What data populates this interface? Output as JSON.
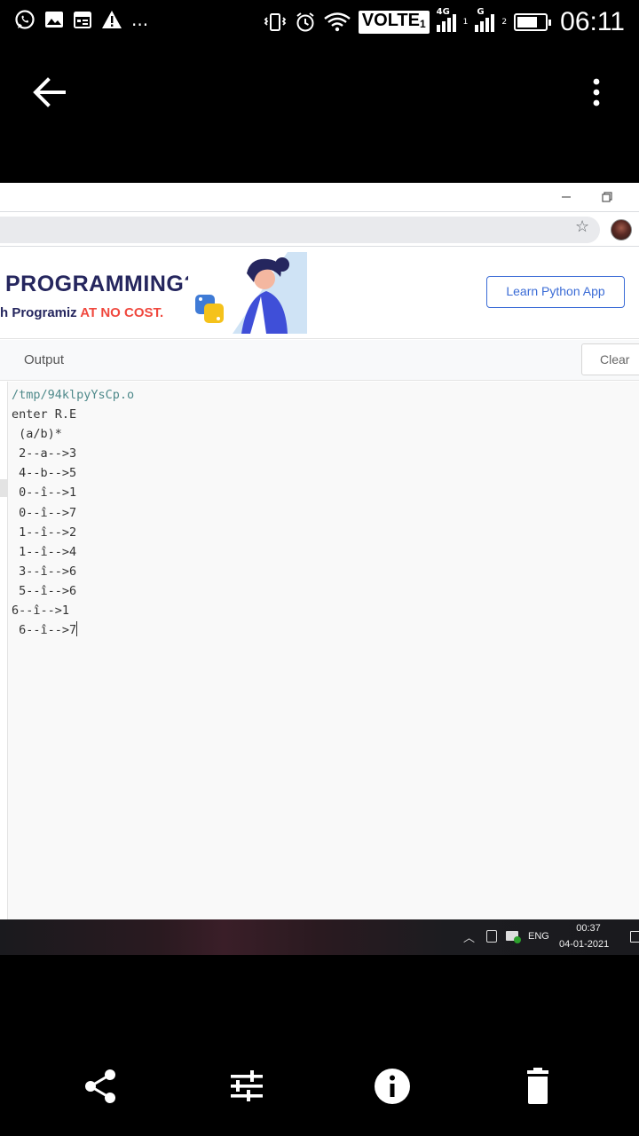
{
  "status_bar": {
    "icons_left": [
      "whatsapp-icon",
      "gallery-icon",
      "calendar-icon",
      "warning-icon",
      "more-notifications-icon"
    ],
    "more_text": "...",
    "network_badge": "VOLTE",
    "sim1_label": "4G",
    "sim2_label": "G",
    "time": "06:11"
  },
  "gallery_bar": {
    "back_icon": "arrow-back-icon",
    "menu_icon": "overflow-menu-icon"
  },
  "browser": {
    "bookmark_icon": "star-icon",
    "profile_icon": "avatar"
  },
  "ad_banner": {
    "title": "PROGRAMMING?",
    "subtitle_prefix": "h Programiz ",
    "subtitle_accent": "AT NO COST.",
    "button_label": "Learn Python App",
    "accent_color": "#f0483e",
    "brand_color": "#25265e",
    "button_color": "#3b6cd6"
  },
  "output_panel": {
    "label": "Output",
    "clear_label": "Clear",
    "lines": [
      "/tmp/94klpyYsCp.o",
      "enter R.E",
      " (a/b)*",
      " 2--a-->3",
      " 4--b-->5",
      " 0--î-->1",
      " 0--î-->7",
      " 1--î-->2",
      " 1--î-->4",
      " 3--î-->6",
      " 5--î-->6",
      "6--î-->1",
      " 6--î-->7"
    ]
  },
  "taskbar": {
    "language": "ENG",
    "time": "00:37",
    "date": "04-01-2021"
  },
  "bottom_actions": [
    "share-icon",
    "edit-adjust-icon",
    "info-icon",
    "delete-icon"
  ]
}
